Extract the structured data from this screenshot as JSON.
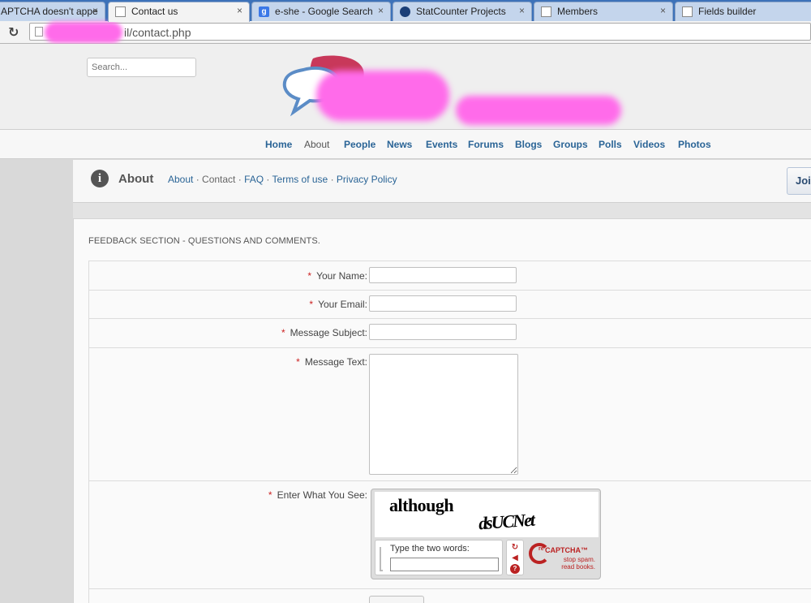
{
  "browser": {
    "tabs": [
      {
        "title": "APTCHA doesn't appe",
        "icon": "page-icon",
        "active": false
      },
      {
        "title": "Contact us",
        "icon": "page-icon",
        "active": true
      },
      {
        "title": "e-she - Google Search",
        "icon": "google-icon",
        "active": false
      },
      {
        "title": "StatCounter Projects",
        "icon": "statcounter-icon",
        "active": false
      },
      {
        "title": "Members",
        "icon": "page-icon",
        "active": false
      },
      {
        "title": "Fields builder",
        "icon": "page-icon",
        "active": false
      }
    ],
    "close_glyph": "×",
    "reload_glyph": "↻",
    "url": "il/contact.php"
  },
  "header": {
    "search_placeholder": "Search...",
    "colors": {
      "bubble_red": "#c8385a",
      "bubble_blue": "#5b8cc6",
      "redaction": "#ff6bea"
    }
  },
  "nav": {
    "items": [
      {
        "label": "Home",
        "current": false
      },
      {
        "label": "About",
        "current": true
      },
      {
        "label": "People",
        "current": false
      },
      {
        "label": "News",
        "current": false
      },
      {
        "label": "Events",
        "current": false
      },
      {
        "label": "Forums",
        "current": false
      },
      {
        "label": "Blogs",
        "current": false
      },
      {
        "label": "Groups",
        "current": false
      },
      {
        "label": "Polls",
        "current": false
      },
      {
        "label": "Videos",
        "current": false
      },
      {
        "label": "Photos",
        "current": false
      }
    ]
  },
  "page_header": {
    "icon_glyph": "i",
    "title": "About",
    "links": [
      {
        "label": "About",
        "link": true
      },
      {
        "label": "Contact",
        "link": false
      },
      {
        "label": "FAQ",
        "link": true
      },
      {
        "label": "Terms of use",
        "link": true
      },
      {
        "label": "Privacy Policy",
        "link": true
      }
    ],
    "separator": " · ",
    "join_label": "Join"
  },
  "feedback": {
    "title": "FEEDBACK SECTION - QUESTIONS AND COMMENTS.",
    "required_mark": "*",
    "fields": {
      "name_label": "Your Name:",
      "email_label": "Your Email:",
      "subject_label": "Message Subject:",
      "text_label": "Message Text:",
      "captcha_label": "Enter What You See:"
    },
    "captcha": {
      "word1": "although",
      "word2": "dsUCNet",
      "prompt": "Type the two words:",
      "brand_prefix": "re",
      "brand": "CAPTCHA™",
      "slogan1": "stop spam.",
      "slogan2": "read books."
    }
  }
}
